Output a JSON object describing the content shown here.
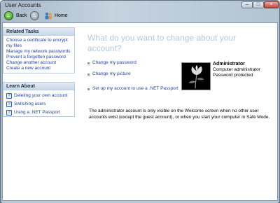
{
  "window": {
    "title": "User Accounts"
  },
  "titlebar_buttons": {
    "minimize": "–",
    "maximize": "□",
    "close": "×"
  },
  "toolbar": {
    "back_label": "Back",
    "home_label": "Home",
    "back_glyph": "←",
    "forward_glyph": "→"
  },
  "sidebar": {
    "related_tasks": {
      "header": "Related Tasks",
      "items": [
        "Choose a certificate to encrypt my files",
        "Manage my network passwords",
        "Prevent a forgotten password",
        "Change another account",
        "Create a new account"
      ]
    },
    "learn_about": {
      "header": "Learn About",
      "items": [
        "Deleting your own account",
        "Switching users",
        "Using a .NET Passport"
      ]
    }
  },
  "main": {
    "heading": "What do you want to change about your account?",
    "actions": [
      "Change my password",
      "Change my picture",
      "Set up my account to use a .NET Passport"
    ],
    "account": {
      "name": "Administrator",
      "type": "Computer administrator",
      "status": "Password protected"
    },
    "note": "The administrator account is only visible on the Welcome screen when no other user accounts exist (except the guest account), or when you start your computer in Safe Mode."
  },
  "colors": {
    "link": "#1d3fb0",
    "heading": "#b3c9e0",
    "panel_border": "#b8cde0"
  }
}
